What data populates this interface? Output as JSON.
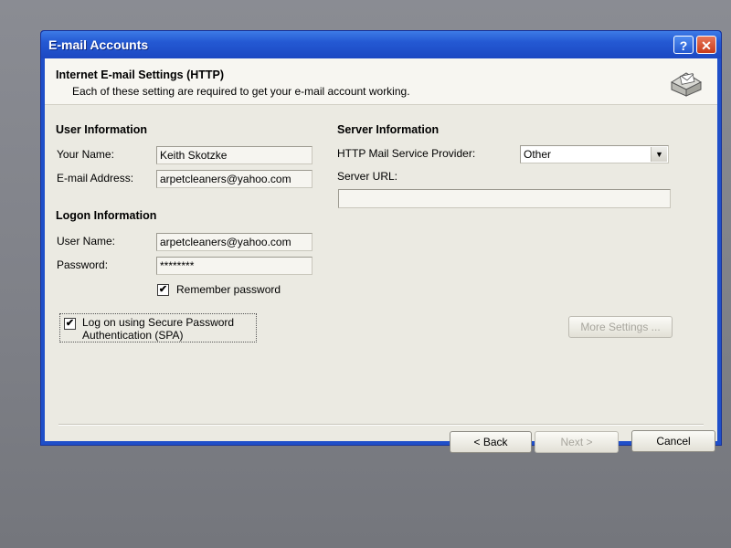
{
  "window": {
    "title": "E-mail Accounts",
    "help_glyph": "?",
    "close_glyph": "✕"
  },
  "header": {
    "title": "Internet E-mail Settings (HTTP)",
    "subtitle": "Each of these setting are required to get your e-mail account working.",
    "icon": "mail-server-icon"
  },
  "user_info": {
    "title": "User Information",
    "name_label": "Your Name:",
    "name_value": "Keith Skotzke",
    "email_label": "E-mail Address:",
    "email_value": "arpetcleaners@yahoo.com"
  },
  "logon_info": {
    "title": "Logon Information",
    "username_label": "User Name:",
    "username_value": "arpetcleaners@yahoo.com",
    "password_label": "Password:",
    "password_value": "********",
    "remember_label": "Remember password",
    "remember_checked": "✔"
  },
  "spa": {
    "label_line1": "Log on using Secure Password",
    "label_line2": "Authentication (SPA)",
    "checked": "✔"
  },
  "server_info": {
    "title": "Server Information",
    "provider_label": "HTTP Mail Service Provider:",
    "provider_value": "Other",
    "url_label": "Server URL:",
    "url_value": ""
  },
  "buttons": {
    "more_settings": "More Settings ...",
    "back": "< Back",
    "next": "Next >",
    "cancel": "Cancel"
  }
}
